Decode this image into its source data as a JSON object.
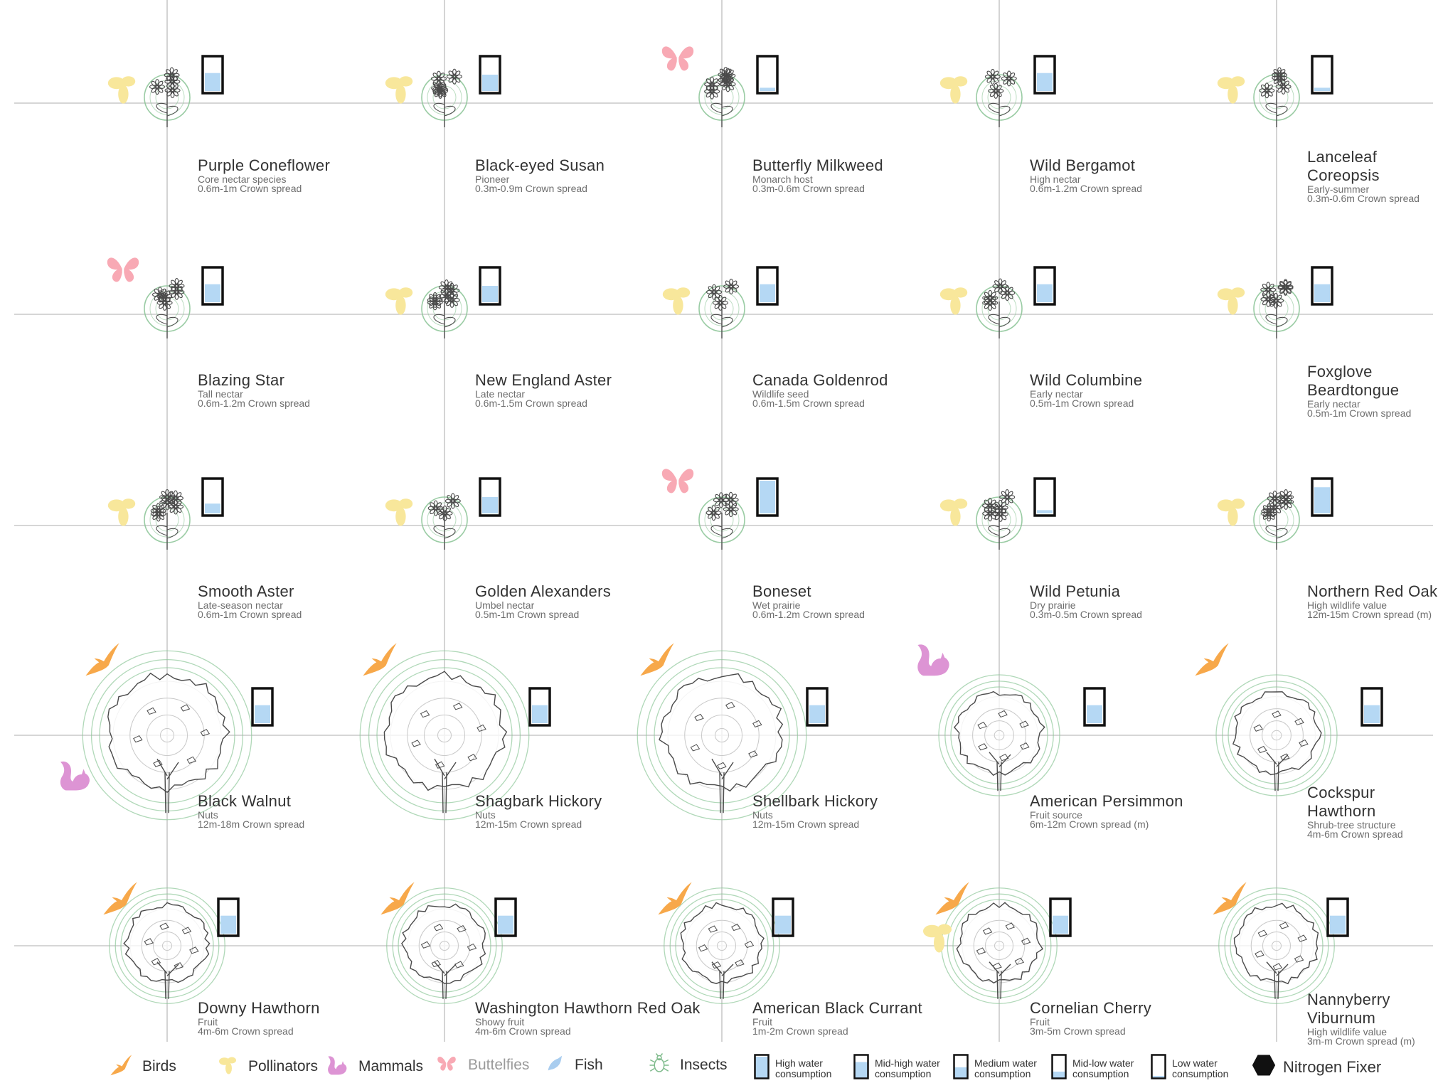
{
  "colors": {
    "bird": "#f7a84a",
    "pollinator": "#f8e79b",
    "mammal": "#dd94d4",
    "butterfly": "#f8a9b4",
    "fish": "#a9cdef",
    "insect": "#7fbb8c",
    "water": "#b5d8f4",
    "ring": "#8fc79a",
    "grid": "#c9c9c9",
    "outline": "#4a4a4a"
  },
  "plants": [
    {
      "name": "Purple Coneflower",
      "note": "Core nectar species",
      "spread": "0.6m-1m Crown spread",
      "kind": "flower",
      "animal": "pollinator",
      "water": 0.55
    },
    {
      "name": "Black-eyed Susan",
      "note": "Pioneer",
      "spread": "0.3m-0.9m Crown spread",
      "kind": "flower",
      "animal": "pollinator",
      "water": 0.5
    },
    {
      "name": "Butterfly Milkweed",
      "note": "Monarch host",
      "spread": "0.3m-0.6m Crown spread",
      "kind": "flower",
      "animal": "butterfly",
      "water": 0.1
    },
    {
      "name": "Wild Bergamot",
      "note": "High nectar",
      "spread": "0.6m-1.2m Crown spread",
      "kind": "flower",
      "animal": "pollinator",
      "water": 0.55
    },
    {
      "name": "Lanceleaf Coreopsis",
      "note": "Early-summer",
      "spread": "0.3m-0.6m Crown spread",
      "kind": "flower",
      "animal": "pollinator",
      "water": 0.1
    },
    {
      "name": "Blazing Star",
      "note": "Tall nectar",
      "spread": "0.6m-1.2m Crown spread",
      "kind": "flower",
      "animal": "butterfly",
      "water": 0.55
    },
    {
      "name": "New England Aster",
      "note": "Late nectar",
      "spread": "0.6m-1.5m Crown spread",
      "kind": "flower",
      "animal": "pollinator",
      "water": 0.5
    },
    {
      "name": "Canada Goldenrod",
      "note": "Wildlife seed",
      "spread": "0.6m-1.5m Crown spread",
      "kind": "flower",
      "animal": "pollinator",
      "water": 0.55
    },
    {
      "name": "Wild Columbine",
      "note": "Early nectar",
      "spread": "0.5m-1m Crown spread",
      "kind": "flower",
      "animal": "pollinator",
      "water": 0.55
    },
    {
      "name": "Foxglove Beardtongue",
      "note": "Early nectar",
      "spread": "0.5m-1m Crown spread",
      "kind": "flower",
      "animal": "pollinator",
      "water": 0.55
    },
    {
      "name": "Smooth Aster",
      "note": "Late-season nectar",
      "spread": "0.6m-1m Crown spread",
      "kind": "flower",
      "animal": "pollinator",
      "water": 0.3
    },
    {
      "name": "Golden Alexanders",
      "note": "Umbel nectar",
      "spread": "0.5m-1m Crown spread",
      "kind": "flower",
      "animal": "pollinator",
      "water": 0.5
    },
    {
      "name": "Boneset",
      "note": "Wet prairie",
      "spread": "0.6m-1.2m Crown spread",
      "kind": "flower",
      "animal": "butterfly",
      "water": 1.0
    },
    {
      "name": "Wild Petunia",
      "note": "Dry prairie",
      "spread": "0.3m-0.5m Crown spread",
      "kind": "flower",
      "animal": "pollinator",
      "water": 0.1
    },
    {
      "name": "Northern Red Oak",
      "note": "High wildlife value",
      "spread": "12m-15m Crown spread (m)",
      "kind": "flower",
      "animal": "pollinator",
      "water": 0.8
    },
    {
      "name": "Black Walnut",
      "note": "Nuts",
      "spread": "12m-18m Crown spread",
      "kind": "tree",
      "animal": "bird",
      "animal2": "mammal",
      "water": 0.55
    },
    {
      "name": "Shagbark Hickory",
      "note": "Nuts",
      "spread": "12m-15m Crown spread",
      "kind": "tree",
      "animal": "bird",
      "water": 0.55
    },
    {
      "name": "Shellbark Hickory",
      "note": "Nuts",
      "spread": "12m-15m Crown spread",
      "kind": "tree",
      "animal": "bird",
      "water": 0.55
    },
    {
      "name": "American Persimmon",
      "note": "Fruit source",
      "spread": "6m-12m Crown spread (m)",
      "kind": "tree",
      "animal": "mammal",
      "water": 0.55
    },
    {
      "name": "Cockspur Hawthorn",
      "note": "Shrub-tree structure",
      "spread": "4m-6m Crown spread",
      "kind": "tree",
      "animal": "bird",
      "water": 0.55
    },
    {
      "name": "Downy Hawthorn",
      "note": "Fruit",
      "spread": "4m-6m Crown spread",
      "kind": "tree",
      "animal": "bird",
      "water": 0.55
    },
    {
      "name": "Washington Hawthorn Red Oak",
      "note": "Showy fruit",
      "spread": "4m-6m Crown spread",
      "kind": "tree",
      "animal": "bird",
      "water": 0.55
    },
    {
      "name": "American Black Currant",
      "note": "Fruit",
      "spread": "1m-2m Crown spread",
      "kind": "tree",
      "animal": "bird",
      "water": 0.55
    },
    {
      "name": "Cornelian Cherry",
      "note": "Fruit",
      "spread": "3m-5m Crown spread",
      "kind": "tree",
      "animal": "bird",
      "animal2": "pollinator",
      "water": 0.55
    },
    {
      "name": "Nannyberry Viburnum",
      "note": "High wildlife value",
      "spread": "3m-m Crown spread (m)",
      "kind": "tree",
      "animal": "bird",
      "water": 0.55
    }
  ],
  "legend": {
    "birds": "Birds",
    "pollinators": "Pollinators",
    "mammals": "Mammals",
    "butterflies": "Buttelfies",
    "fish": "Fish",
    "insects": "Insects",
    "water_high": "High water consumption",
    "water_midhigh": "Mid-high water consumption",
    "water_medium": "Medium water consumption",
    "water_midlow": "Mid-low water consumption",
    "water_low": "Low water consumption",
    "nitrogen": "Nitrogen Fixer"
  },
  "legend_water_levels": [
    1.0,
    0.75,
    0.5,
    0.3,
    0.1
  ]
}
